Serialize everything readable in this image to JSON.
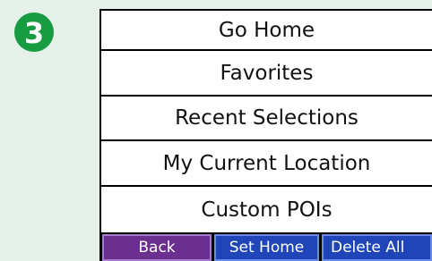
{
  "step": {
    "number": "3",
    "color": "#179c41"
  },
  "menu": {
    "items": [
      {
        "label": "Go Home"
      },
      {
        "label": "Favorites"
      },
      {
        "label": "Recent Selections"
      },
      {
        "label": "My Current Location"
      },
      {
        "label": "Custom POIs"
      }
    ]
  },
  "toolbar": {
    "back_label": "Back",
    "set_home_label": "Set Home",
    "delete_all_label": "Delete All"
  },
  "colors": {
    "background": "#e6f1e9",
    "back_button": "#6a2f8f",
    "action_button": "#1f45b8"
  }
}
